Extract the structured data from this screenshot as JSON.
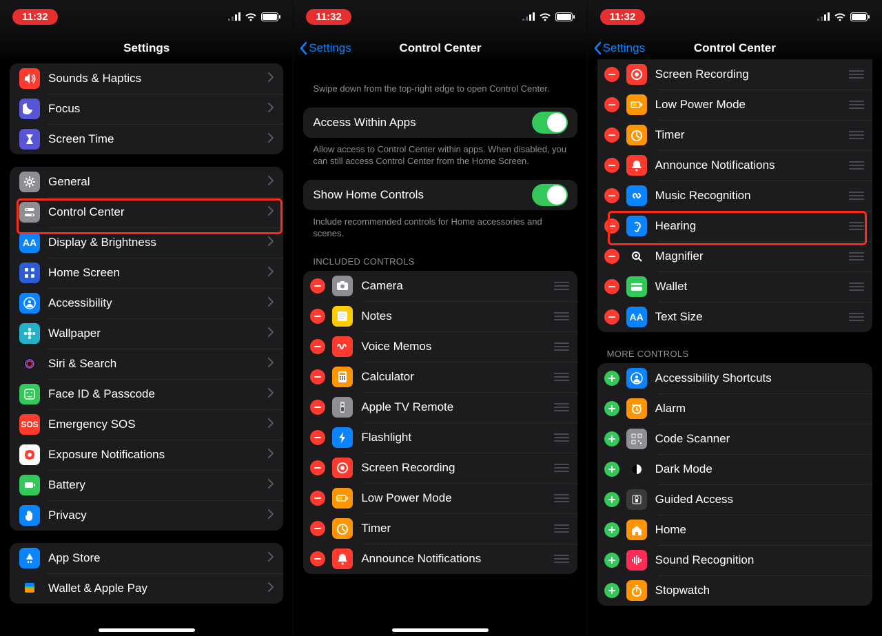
{
  "status_time": "11:32",
  "panel1": {
    "title": "Settings",
    "groupA": [
      {
        "label": "Sounds & Haptics",
        "bg": "#ff3b30",
        "glyph": "speaker"
      },
      {
        "label": "Focus",
        "bg": "#5856d6",
        "glyph": "moon"
      },
      {
        "label": "Screen Time",
        "bg": "#5856d6",
        "glyph": "hourglass"
      }
    ],
    "groupB": [
      {
        "label": "General",
        "bg": "#8e8e93",
        "glyph": "gear"
      },
      {
        "label": "Control Center",
        "bg": "#8e8e93",
        "glyph": "switches"
      },
      {
        "label": "Display & Brightness",
        "bg": "#0a84ff",
        "glyph": "aa"
      },
      {
        "label": "Home Screen",
        "bg": "#2e5bd6",
        "glyph": "grid"
      },
      {
        "label": "Accessibility",
        "bg": "#0a84ff",
        "glyph": "person"
      },
      {
        "label": "Wallpaper",
        "bg": "#24b0c9",
        "glyph": "flower"
      },
      {
        "label": "Siri & Search",
        "bg": "#1c1c1e",
        "glyph": "siri"
      },
      {
        "label": "Face ID & Passcode",
        "bg": "#34c759",
        "glyph": "face"
      },
      {
        "label": "Emergency SOS",
        "bg": "#ff3b30",
        "glyph": "sos"
      },
      {
        "label": "Exposure Notifications",
        "bg": "#fff",
        "glyph": "exposure"
      },
      {
        "label": "Battery",
        "bg": "#34c759",
        "glyph": "battery"
      },
      {
        "label": "Privacy",
        "bg": "#0a84ff",
        "glyph": "hand"
      }
    ],
    "groupC": [
      {
        "label": "App Store",
        "bg": "#0a84ff",
        "glyph": "appstore"
      },
      {
        "label": "Wallet & Apple Pay",
        "bg": "#1c1c1e",
        "glyph": "wallet"
      }
    ]
  },
  "panel2": {
    "back": "Settings",
    "title": "Control Center",
    "intro": "Swipe down from the top-right edge to open Control Center.",
    "toggle1_label": "Access Within Apps",
    "toggle1_desc": "Allow access to Control Center within apps. When disabled, you can still access Control Center from the Home Screen.",
    "toggle2_label": "Show Home Controls",
    "toggle2_desc": "Include recommended controls for Home accessories and scenes.",
    "included_header": "INCLUDED CONTROLS",
    "included": [
      {
        "label": "Camera",
        "bg": "#8e8e93",
        "glyph": "camera"
      },
      {
        "label": "Notes",
        "bg": "#ffcc00",
        "glyph": "notes"
      },
      {
        "label": "Voice Memos",
        "bg": "#ff3b30",
        "glyph": "wave"
      },
      {
        "label": "Calculator",
        "bg": "#ff9500",
        "glyph": "calc"
      },
      {
        "label": "Apple TV Remote",
        "bg": "#8e8e93",
        "glyph": "remote"
      },
      {
        "label": "Flashlight",
        "bg": "#0a84ff",
        "glyph": "flash"
      },
      {
        "label": "Screen Recording",
        "bg": "#ff3b30",
        "glyph": "record"
      },
      {
        "label": "Low Power Mode",
        "bg": "#ff9500",
        "glyph": "lpbatt"
      },
      {
        "label": "Timer",
        "bg": "#ff9500",
        "glyph": "timer"
      },
      {
        "label": "Announce Notifications",
        "bg": "#ff3b30",
        "glyph": "bell"
      }
    ]
  },
  "panel3": {
    "back": "Settings",
    "title": "Control Center",
    "included_tail": [
      {
        "label": "Screen Recording",
        "bg": "#ff3b30",
        "glyph": "record"
      },
      {
        "label": "Low Power Mode",
        "bg": "#ff9500",
        "glyph": "lpbatt"
      },
      {
        "label": "Timer",
        "bg": "#ff9500",
        "glyph": "timer"
      },
      {
        "label": "Announce Notifications",
        "bg": "#ff3b30",
        "glyph": "bell"
      },
      {
        "label": "Music Recognition",
        "bg": "#0a84ff",
        "glyph": "shazam"
      },
      {
        "label": "Hearing",
        "bg": "#0a84ff",
        "glyph": "ear"
      },
      {
        "label": "Magnifier",
        "bg": "#1c1c1e",
        "glyph": "mag"
      },
      {
        "label": "Wallet",
        "bg": "#34c759",
        "glyph": "wallet2"
      },
      {
        "label": "Text Size",
        "bg": "#0a84ff",
        "glyph": "aa"
      }
    ],
    "more_header": "MORE CONTROLS",
    "more": [
      {
        "label": "Accessibility Shortcuts",
        "bg": "#0a84ff",
        "glyph": "person"
      },
      {
        "label": "Alarm",
        "bg": "#ff9500",
        "glyph": "alarm"
      },
      {
        "label": "Code Scanner",
        "bg": "#8e8e93",
        "glyph": "qr"
      },
      {
        "label": "Dark Mode",
        "bg": "#1c1c1e",
        "glyph": "dark"
      },
      {
        "label": "Guided Access",
        "bg": "#3a3a3c",
        "glyph": "lock"
      },
      {
        "label": "Home",
        "bg": "#ff9500",
        "glyph": "home"
      },
      {
        "label": "Sound Recognition",
        "bg": "#ff2d55",
        "glyph": "sound"
      },
      {
        "label": "Stopwatch",
        "bg": "#ff9500",
        "glyph": "stopwatch"
      }
    ]
  }
}
